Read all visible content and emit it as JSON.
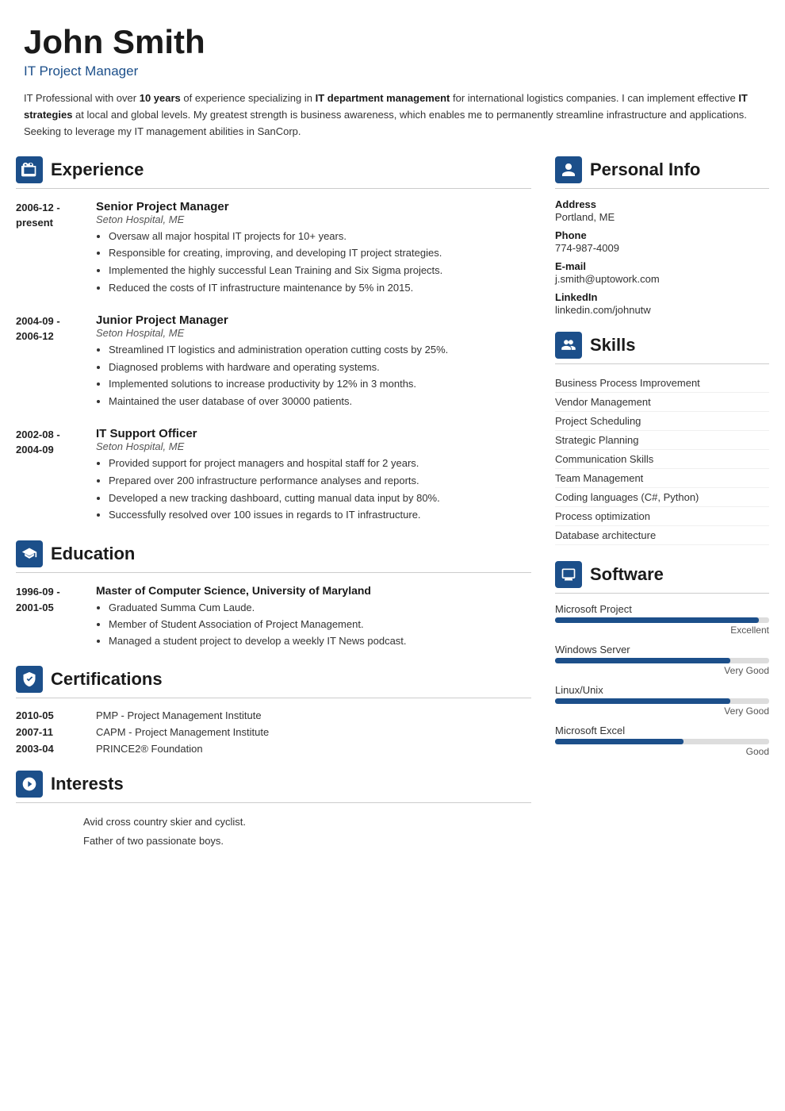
{
  "header": {
    "name": "John Smith",
    "title": "IT Project Manager",
    "summary_parts": [
      {
        "text": "IT Professional with over ",
        "bold": false
      },
      {
        "text": "10 years",
        "bold": true
      },
      {
        "text": " of experience specializing in ",
        "bold": false
      },
      {
        "text": "IT department management",
        "bold": true
      },
      {
        "text": " for international logistics companies. I can implement effective ",
        "bold": false
      },
      {
        "text": "IT strategies",
        "bold": true
      },
      {
        "text": " at local and global levels. My greatest strength is business awareness, which enables me to permanently streamline infrastructure and applications. Seeking to leverage my IT management abilities in SanCorp.",
        "bold": false
      }
    ]
  },
  "experience": {
    "section_title": "Experience",
    "entries": [
      {
        "date_start": "2006-12 -",
        "date_end": "present",
        "job_title": "Senior Project Manager",
        "company": "Seton Hospital, ME",
        "bullets": [
          "Oversaw all major hospital IT projects for 10+ years.",
          "Responsible for creating, improving, and developing IT project strategies.",
          "Implemented the highly successful Lean Training and Six Sigma projects.",
          "Reduced the costs of IT infrastructure maintenance by 5% in 2015."
        ]
      },
      {
        "date_start": "2004-09 -",
        "date_end": "2006-12",
        "job_title": "Junior Project Manager",
        "company": "Seton Hospital, ME",
        "bullets": [
          "Streamlined IT logistics and administration operation cutting costs by 25%.",
          "Diagnosed problems with hardware and operating systems.",
          "Implemented solutions to increase productivity by 12% in 3 months.",
          "Maintained the user database of over 30000 patients."
        ]
      },
      {
        "date_start": "2002-08 -",
        "date_end": "2004-09",
        "job_title": "IT Support Officer",
        "company": "Seton Hospital, ME",
        "bullets": [
          "Provided support for project managers and hospital staff for 2 years.",
          "Prepared over 200 infrastructure performance analyses and reports.",
          "Developed a new tracking dashboard, cutting manual data input by 80%.",
          "Successfully resolved over 100 issues in regards to IT infrastructure."
        ]
      }
    ]
  },
  "education": {
    "section_title": "Education",
    "entries": [
      {
        "date_start": "1996-09 -",
        "date_end": "2001-05",
        "degree": "Master of Computer Science, University of Maryland",
        "bullets": [
          "Graduated Summa Cum Laude.",
          "Member of Student Association of Project Management.",
          "Managed a student project to develop a weekly IT News podcast."
        ]
      }
    ]
  },
  "certifications": {
    "section_title": "Certifications",
    "entries": [
      {
        "date": "2010-05",
        "name": "PMP - Project Management Institute"
      },
      {
        "date": "2007-11",
        "name": "CAPM - Project Management Institute"
      },
      {
        "date": "2003-04",
        "name": "PRINCE2® Foundation"
      }
    ]
  },
  "interests": {
    "section_title": "Interests",
    "entries": [
      "Avid cross country skier and cyclist.",
      "Father of two passionate boys."
    ]
  },
  "personal_info": {
    "section_title": "Personal Info",
    "fields": [
      {
        "label": "Address",
        "value": "Portland, ME"
      },
      {
        "label": "Phone",
        "value": "774-987-4009"
      },
      {
        "label": "E-mail",
        "value": "j.smith@uptowork.com"
      },
      {
        "label": "LinkedIn",
        "value": "linkedin.com/johnutw"
      }
    ]
  },
  "skills": {
    "section_title": "Skills",
    "items": [
      "Business Process Improvement",
      "Vendor Management",
      "Project Scheduling",
      "Strategic Planning",
      "Communication Skills",
      "Team Management",
      "Coding languages (C#, Python)",
      "Process optimization",
      "Database architecture"
    ]
  },
  "software": {
    "section_title": "Software",
    "items": [
      {
        "name": "Microsoft Project",
        "percent": 95,
        "label": "Excellent"
      },
      {
        "name": "Windows Server",
        "percent": 82,
        "label": "Very Good"
      },
      {
        "name": "Linux/Unix",
        "percent": 82,
        "label": "Very Good"
      },
      {
        "name": "Microsoft Excel",
        "percent": 60,
        "label": "Good"
      }
    ]
  },
  "colors": {
    "accent": "#1c4f8a",
    "bar_fill": "#1c4f8a",
    "bar_track": "#ddd"
  }
}
